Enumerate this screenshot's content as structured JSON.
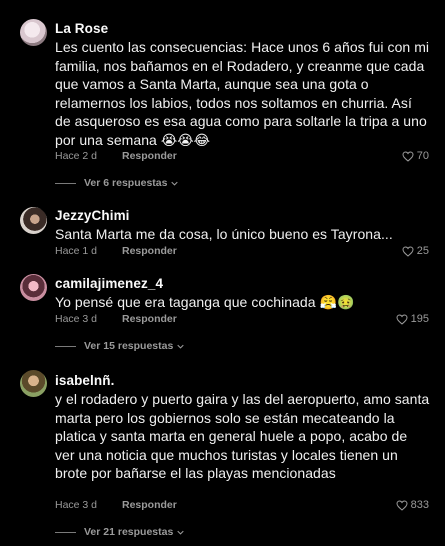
{
  "comments": [
    {
      "username": "La Rose",
      "text": "Les cuento las consecuencias: Hace unos 6 años fui con mi familia, nos bañamos en el Rodadero, y creanme que cada que vamos a Santa Marta, aunque sea una gota o relamernos los labios, todos nos soltamos en churria. Así de asqueroso es esa agua como para soltarle la tripa a uno por una semana 😭😭😂",
      "time": "Hace 2 d",
      "reply": "Responder",
      "likes": "70",
      "view_replies": "Ver 6 respuestas"
    },
    {
      "username": "JezzyChimi",
      "text": "Santa Marta me da cosa, lo único bueno es Tayrona...",
      "time": "Hace 1 d",
      "reply": "Responder",
      "likes": "25"
    },
    {
      "username": "camilajimenez_4",
      "text": "Yo pensé que era taganga que cochinada 😤🤢",
      "time": "Hace 3 d",
      "reply": "Responder",
      "likes": "195",
      "view_replies": "Ver 15 respuestas"
    },
    {
      "username": "isabelnñ.",
      "text": "y el rodadero y puerto gaira y las del aeropuerto, amo santa marta pero los gobiernos solo se están mecateando la platica y santa marta en general huele a popo, acabo de ver una noticia que muchos turistas y locales tienen un brote por bañarse el las playas mencionadas",
      "time": "Hace 3 d",
      "reply": "Responder",
      "likes": "833",
      "view_replies": "Ver 21 respuestas"
    }
  ],
  "icons": {
    "like": "heart-outline-icon",
    "expand": "chevron-down-icon"
  },
  "colors": {
    "background": "#000000",
    "text": "#f0f0f0",
    "muted": "#9a9a9a"
  }
}
